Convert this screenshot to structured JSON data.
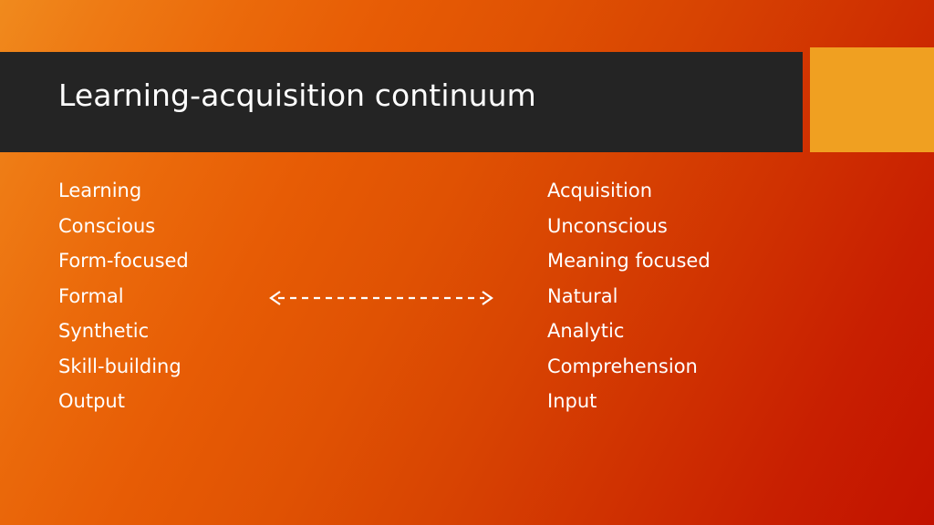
{
  "slide": {
    "title": "Learning-acquisition continuum",
    "accent_color": "#f0a021",
    "title_bar_color": "#242424",
    "background_from": "#f08a1d",
    "background_to": "#c21200",
    "text_color": "#ffffff"
  },
  "columns": {
    "left": {
      "items": [
        "Learning",
        "Conscious",
        "Form-focused",
        "Formal",
        "Synthetic",
        "Skill-building",
        "Output"
      ]
    },
    "right": {
      "items": [
        "Acquisition",
        "Unconscious",
        "Meaning focused",
        "Natural",
        "Analytic",
        "Comprehension",
        "Input"
      ]
    }
  },
  "arrow": {
    "icon": "double-headed-dashed-arrow",
    "color": "#ffffff"
  }
}
